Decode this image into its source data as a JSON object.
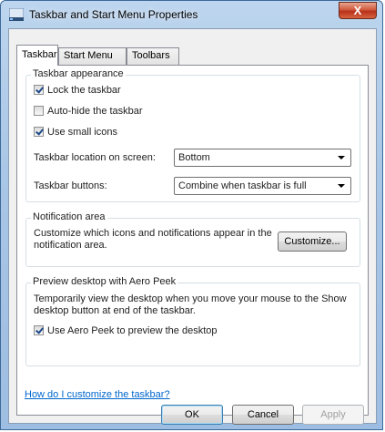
{
  "window": {
    "title": "Taskbar and Start Menu Properties",
    "close_label": "X"
  },
  "tabs": [
    {
      "label": "Taskbar",
      "active": true
    },
    {
      "label": "Start Menu",
      "active": false
    },
    {
      "label": "Toolbars",
      "active": false
    }
  ],
  "taskbar_appearance": {
    "title": "Taskbar appearance",
    "lock": {
      "label": "Lock the taskbar",
      "checked": true
    },
    "autohide": {
      "label": "Auto-hide the taskbar",
      "checked": false
    },
    "small_icons": {
      "label": "Use small icons",
      "checked": true
    },
    "location_label": "Taskbar location on screen:",
    "location_value": "Bottom",
    "buttons_label": "Taskbar buttons:",
    "buttons_value": "Combine when taskbar is full"
  },
  "notification_area": {
    "title": "Notification area",
    "text": "Customize which icons and notifications appear in the notification area.",
    "customize_label": "Customize..."
  },
  "aero_peek": {
    "title": "Preview desktop with Aero Peek",
    "text": "Temporarily view the desktop when you move your mouse to the Show desktop button at end of the taskbar.",
    "checkbox": {
      "label": "Use Aero Peek to preview the desktop",
      "checked": true
    }
  },
  "help_link": "How do I customize the taskbar?",
  "footer": {
    "ok": "OK",
    "cancel": "Cancel",
    "apply": "Apply"
  }
}
